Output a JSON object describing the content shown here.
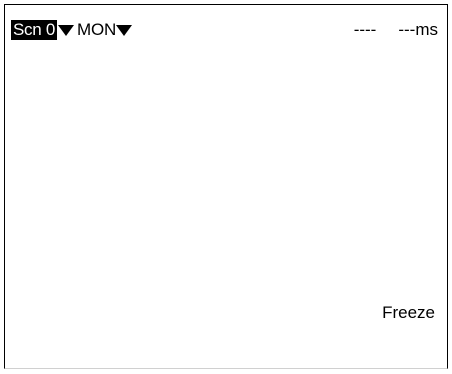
{
  "scene_select": {
    "label": "Scn 0",
    "icon": "triangle-down-icon"
  },
  "mode_select": {
    "label": "MON",
    "icon": "triangle-down-icon"
  },
  "status": {
    "result": "----",
    "time": "---ms"
  },
  "freeze_label": "Freeze",
  "colors": {
    "background": "#ffffff",
    "text": "#000000",
    "highlight_bg": "#000000",
    "highlight_text": "#ffffff"
  }
}
